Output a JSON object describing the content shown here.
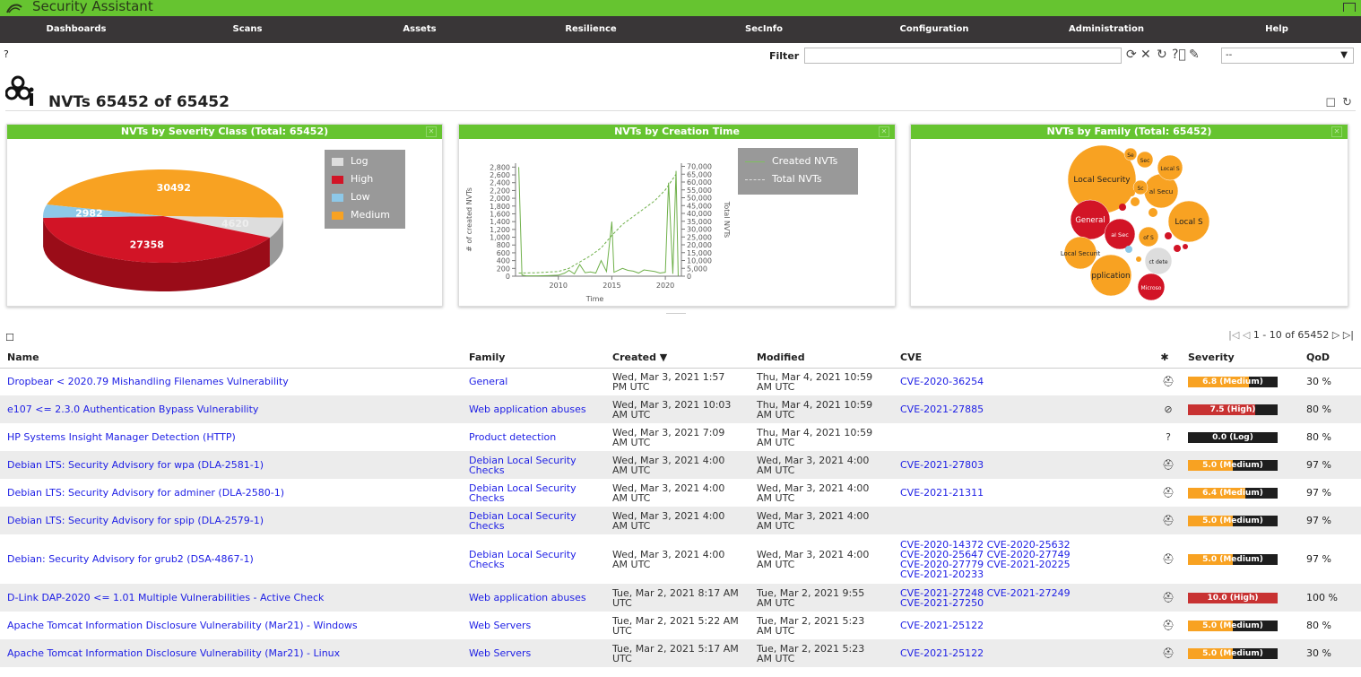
{
  "app": {
    "title": "Security Assistant"
  },
  "menu": [
    "Dashboards",
    "Scans",
    "Assets",
    "Resilience",
    "SecInfo",
    "Configuration",
    "Administration",
    "Help"
  ],
  "filter": {
    "label": "Filter",
    "value": "",
    "select_value": "--"
  },
  "page": {
    "title": "NVTs 65452 of 65452"
  },
  "charts": {
    "severity": {
      "title": "NVTs by Severity Class (Total: 65452)",
      "chart_data": {
        "type": "pie",
        "title": "NVTs by Severity Class (Total: 65452)",
        "slices": [
          {
            "label": "Medium",
            "value": 30492,
            "color": "#f8a222"
          },
          {
            "label": "Log",
            "value": 4620,
            "color": "#dddddd"
          },
          {
            "label": "High",
            "value": 27358,
            "color": "#d21426"
          },
          {
            "label": "Low",
            "value": 2982,
            "color": "#8dc8e8"
          }
        ],
        "legend": [
          "Log",
          "High",
          "Low",
          "Medium"
        ],
        "legend_position": "top-right"
      }
    },
    "creation": {
      "title": "NVTs by Creation Time",
      "chart_data": {
        "type": "line",
        "title": "NVTs by Creation Time",
        "xlabel": "Time",
        "ylabel": "# of created NVTs",
        "y2label": "Total NVTs",
        "xticks": [
          "2010",
          "2015",
          "2020"
        ],
        "yticks": [
          0,
          200,
          400,
          600,
          800,
          1000,
          1200,
          1400,
          1600,
          1800,
          2000,
          2200,
          2400,
          2600,
          2800
        ],
        "y2ticks": [
          0,
          5000,
          10000,
          15000,
          20000,
          25000,
          30000,
          35000,
          40000,
          45000,
          50000,
          55000,
          60000,
          65000,
          70000
        ],
        "ylim": [
          0,
          2900
        ],
        "y2lim": [
          0,
          72000
        ],
        "series": [
          {
            "name": "Created NVTs",
            "points": [
              [
                2006.3,
                2800
              ],
              [
                2006.6,
                30
              ],
              [
                2007,
                8
              ],
              [
                2008,
                10
              ],
              [
                2009,
                15
              ],
              [
                2010,
                25
              ],
              [
                2010.6,
                80
              ],
              [
                2011,
                150
              ],
              [
                2011.5,
                60
              ],
              [
                2012,
                300
              ],
              [
                2012.5,
                90
              ],
              [
                2013,
                110
              ],
              [
                2013.5,
                80
              ],
              [
                2014,
                400
              ],
              [
                2014.5,
                120
              ],
              [
                2015,
                1400
              ],
              [
                2015.2,
                100
              ],
              [
                2016,
                200
              ],
              [
                2016.5,
                150
              ],
              [
                2017,
                130
              ],
              [
                2017.5,
                80
              ],
              [
                2018,
                160
              ],
              [
                2019,
                120
              ],
              [
                2019.5,
                80
              ],
              [
                2020,
                100
              ],
              [
                2020.3,
                2400
              ],
              [
                2020.7,
                60
              ],
              [
                2021,
                2700
              ],
              [
                2021.2,
                10
              ]
            ]
          },
          {
            "name": "Total NVTs",
            "points": [
              [
                2006.3,
                2000
              ],
              [
                2008,
                2200
              ],
              [
                2010,
                3000
              ],
              [
                2011,
                5000
              ],
              [
                2012,
                9000
              ],
              [
                2013,
                13000
              ],
              [
                2014,
                18000
              ],
              [
                2015,
                26000
              ],
              [
                2016,
                33000
              ],
              [
                2017,
                38000
              ],
              [
                2018,
                43000
              ],
              [
                2019,
                48000
              ],
              [
                2020,
                55000
              ],
              [
                2021,
                65000
              ]
            ]
          }
        ],
        "legend": [
          "Created NVTs",
          "Total NVTs"
        ],
        "legend_position": "top-right"
      }
    },
    "family": {
      "title": "NVTs by Family (Total: 65452)",
      "bubbles": [
        {
          "label": "Local Security",
          "color": "#f8a222"
        },
        {
          "label": "General",
          "color": "#d21426"
        },
        {
          "label": "Local Securit",
          "color": "#f8a222"
        },
        {
          "label": "pplication",
          "color": "#f8a222"
        },
        {
          "label": "Local S",
          "color": "#f8a222"
        },
        {
          "label": "al Secu",
          "color": "#f8a222"
        },
        {
          "label": "Local S",
          "color": "#f8a222"
        },
        {
          "label": "al Sec",
          "color": "#d21426"
        },
        {
          "label": "Microso",
          "color": "#d21426"
        },
        {
          "label": "ct dete",
          "color": "#dddddd"
        },
        {
          "label": "of S",
          "color": "#f8a222"
        },
        {
          "label": "Sec",
          "color": "#f8a222"
        },
        {
          "label": "Se",
          "color": "#f8a222"
        },
        {
          "label": "Sc",
          "color": "#f8a222"
        }
      ]
    }
  },
  "table": {
    "pager": "1 - 10 of 65452",
    "headers": {
      "name": "Name",
      "family": "Family",
      "created": "Created ▼",
      "modified": "Modified",
      "cve": "CVE",
      "severity": "Severity",
      "qod": "QoD"
    },
    "rows": [
      {
        "name": "Dropbear < 2020.79 Mishandling Filenames Vulnerability",
        "family": "General",
        "created": "Wed, Mar 3, 2021 1:57 PM UTC",
        "modified": "Thu, Mar 4, 2021 10:59 AM UTC",
        "cve": [
          "CVE-2020-36254"
        ],
        "solution": "vendorfix",
        "severity": "6.8 (Medium)",
        "severity_value": 6.8,
        "severity_color": "#f8a222",
        "qod": "30 %"
      },
      {
        "name": "e107 <= 2.3.0 Authentication Bypass Vulnerability",
        "family": "Web application abuses",
        "created": "Wed, Mar 3, 2021 10:03 AM UTC",
        "modified": "Thu, Mar 4, 2021 10:59 AM UTC",
        "cve": [
          "CVE-2021-27885"
        ],
        "solution": "nofix",
        "severity": "7.5 (High)",
        "severity_value": 7.5,
        "severity_color": "#c83232",
        "qod": "80 %"
      },
      {
        "name": "HP Systems Insight Manager Detection (HTTP)",
        "family": "Product detection",
        "created": "Wed, Mar 3, 2021 7:09 AM UTC",
        "modified": "Thu, Mar 4, 2021 10:59 AM UTC",
        "cve": [],
        "solution": "unknown",
        "severity": "0.0 (Log)",
        "severity_value": 0.0,
        "severity_color": "#dddddd",
        "qod": "80 %"
      },
      {
        "name": "Debian LTS: Security Advisory for wpa (DLA-2581-1)",
        "family": "Debian Local Security Checks",
        "created": "Wed, Mar 3, 2021 4:00 AM UTC",
        "modified": "Wed, Mar 3, 2021 4:00 AM UTC",
        "cve": [
          "CVE-2021-27803"
        ],
        "solution": "vendorfix",
        "severity": "5.0 (Medium)",
        "severity_value": 5.0,
        "severity_color": "#f8a222",
        "qod": "97 %"
      },
      {
        "name": "Debian LTS: Security Advisory for adminer (DLA-2580-1)",
        "family": "Debian Local Security Checks",
        "created": "Wed, Mar 3, 2021 4:00 AM UTC",
        "modified": "Wed, Mar 3, 2021 4:00 AM UTC",
        "cve": [
          "CVE-2021-21311"
        ],
        "solution": "vendorfix",
        "severity": "6.4 (Medium)",
        "severity_value": 6.4,
        "severity_color": "#f8a222",
        "qod": "97 %"
      },
      {
        "name": "Debian LTS: Security Advisory for spip (DLA-2579-1)",
        "family": "Debian Local Security Checks",
        "created": "Wed, Mar 3, 2021 4:00 AM UTC",
        "modified": "Wed, Mar 3, 2021 4:00 AM UTC",
        "cve": [],
        "solution": "vendorfix",
        "severity": "5.0 (Medium)",
        "severity_value": 5.0,
        "severity_color": "#f8a222",
        "qod": "97 %"
      },
      {
        "name": "Debian: Security Advisory for grub2 (DSA-4867-1)",
        "family": "Debian Local Security Checks",
        "created": "Wed, Mar 3, 2021 4:00 AM UTC",
        "modified": "Wed, Mar 3, 2021 4:00 AM UTC",
        "cve": [
          "CVE-2020-14372",
          "CVE-2020-25632",
          "CVE-2020-25647",
          "CVE-2020-27749",
          "CVE-2020-27779",
          "CVE-2021-20225",
          "CVE-2021-20233"
        ],
        "solution": "vendorfix",
        "severity": "5.0 (Medium)",
        "severity_value": 5.0,
        "severity_color": "#f8a222",
        "qod": "97 %",
        "tall": true
      },
      {
        "name": "D-Link DAP-2020 <= 1.01 Multiple Vulnerabilities - Active Check",
        "family": "Web application abuses",
        "created": "Tue, Mar 2, 2021 8:17 AM UTC",
        "modified": "Tue, Mar 2, 2021 9:55 AM UTC",
        "cve": [
          "CVE-2021-27248",
          "CVE-2021-27249",
          "CVE-2021-27250"
        ],
        "solution": "vendorfix",
        "severity": "10.0 (High)",
        "severity_value": 10.0,
        "severity_color": "#c83232",
        "qod": "100 %"
      },
      {
        "name": "Apache Tomcat Information Disclosure Vulnerability (Mar21) - Windows",
        "family": "Web Servers",
        "created": "Tue, Mar 2, 2021 5:22 AM UTC",
        "modified": "Tue, Mar 2, 2021 5:23 AM UTC",
        "cve": [
          "CVE-2021-25122"
        ],
        "solution": "vendorfix",
        "severity": "5.0 (Medium)",
        "severity_value": 5.0,
        "severity_color": "#f8a222",
        "qod": "80 %"
      },
      {
        "name": "Apache Tomcat Information Disclosure Vulnerability (Mar21) - Linux",
        "family": "Web Servers",
        "created": "Tue, Mar 2, 2021 5:17 AM UTC",
        "modified": "Tue, Mar 2, 2021 5:23 AM UTC",
        "cve": [
          "CVE-2021-25122"
        ],
        "solution": "vendorfix",
        "severity": "5.0 (Medium)",
        "severity_value": 5.0,
        "severity_color": "#f8a222",
        "qod": "30 %"
      }
    ]
  }
}
